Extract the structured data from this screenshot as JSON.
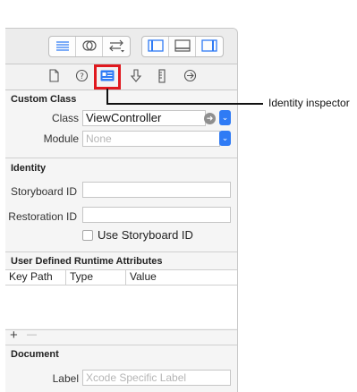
{
  "toolbar": {
    "groups": [
      {
        "icons": [
          "align-left-lines-icon",
          "intersect-circles-icon",
          "swap-arrows-icon"
        ]
      },
      {
        "icons": [
          "left-panel-icon",
          "bottom-panel-icon",
          "right-panel-icon"
        ]
      }
    ]
  },
  "inspector_tabs": [
    {
      "icon": "file-icon"
    },
    {
      "icon": "help-icon"
    },
    {
      "icon": "identity-card-icon",
      "active": true
    },
    {
      "icon": "attributes-arrow-icon"
    },
    {
      "icon": "ruler-icon"
    },
    {
      "icon": "connections-arrow-icon"
    }
  ],
  "custom_class": {
    "title": "Custom Class",
    "class_label": "Class",
    "class_value": "ViewController",
    "module_label": "Module",
    "module_placeholder": "None"
  },
  "identity": {
    "title": "Identity",
    "storyboard_id_label": "Storyboard ID",
    "storyboard_id_value": "",
    "restoration_id_label": "Restoration ID",
    "restoration_id_value": "",
    "use_storyboard_id_label": "Use Storyboard ID",
    "use_storyboard_id_checked": false
  },
  "runtime_attributes": {
    "title": "User Defined Runtime Attributes",
    "columns": [
      "Key Path",
      "Type",
      "Value"
    ],
    "rows": [],
    "add_label": "+",
    "remove_label": "—"
  },
  "document": {
    "title": "Document",
    "label_label": "Label",
    "label_placeholder": "Xcode Specific Label"
  },
  "callout": {
    "text": "Identity inspector"
  },
  "colors": {
    "active_tab_highlight": "#e0191f",
    "accent": "#2f7bf5"
  }
}
